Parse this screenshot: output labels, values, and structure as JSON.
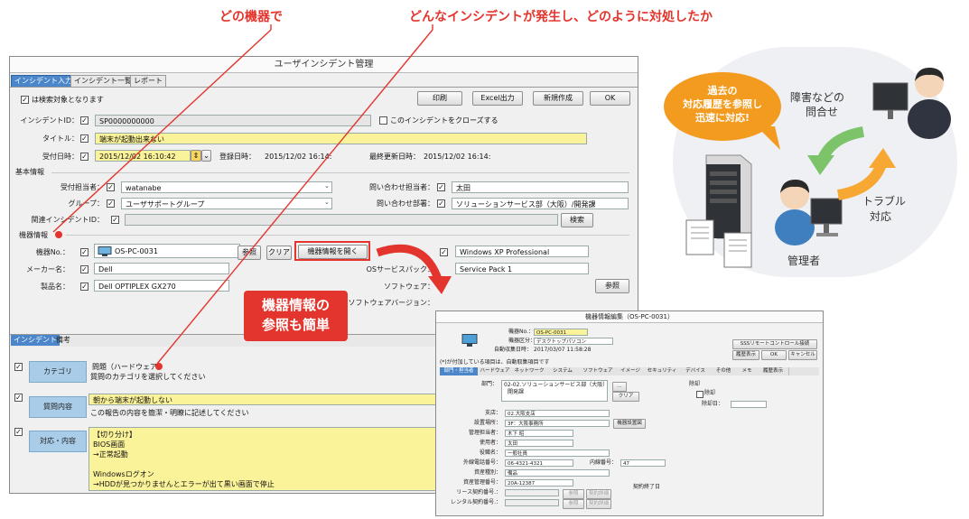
{
  "callouts": {
    "which_device": "どの機器で",
    "what_incident": "どんなインシデントが発生し、どのように対処したか"
  },
  "main_window": {
    "title": "ユーザインシデント管理",
    "tabs": [
      "インシデント入力",
      "インシデント一覧",
      "レポート"
    ],
    "search_target_label": "は検索対象となります",
    "toolbar": {
      "print": "印刷",
      "excel": "Excel出力",
      "new": "新規作成",
      "ok": "OK"
    },
    "incident_id_label": "インシデントID：",
    "incident_id_value": "SP0000000000",
    "close_label": "このインシデントをクローズする",
    "title_label": "タイトル：",
    "title_value": "端末が起動出来ない",
    "received_label": "受付日時：",
    "received_value": "2015/12/02 16:10:42",
    "registered_label": "登録日時：",
    "registered_value": "2015/12/02 16:14:",
    "updated_label": "最終更新日時：",
    "updated_value": "2015/12/02 16:14:",
    "basic_section": "基本情報",
    "receiver_label": "受付担当者：",
    "receiver_value": "watanabe",
    "group_label": "グループ：",
    "group_value": "ユーザサポートグループ",
    "contact_label": "問い合わせ担当者：",
    "contact_value": "太田",
    "dept_label": "問い合わせ部署：",
    "dept_value": "ソリューションサービス部（大阪）/開発課",
    "related_label": "関連インシデントID：",
    "search_button": "検索",
    "device_section": "機器情報",
    "device_no_label": "機器No.：",
    "device_no_value": "OS-PC-0031",
    "ref_button": "参照",
    "clear_button": "クリア",
    "open_device_button": "機器情報を開く",
    "maker_label": "メーカー名：",
    "maker_value": "Dell",
    "product_label": "製品名：",
    "product_value": "Dell OPTIPLEX GX270",
    "os_value": "Windows XP Professional",
    "os_service_label": "OSサービスパック：",
    "os_service_value": "Service Pack 1",
    "software_label": "ソフトウェア：",
    "software_ref_button": "参照",
    "software_version_label": "ソフトウェアバージョン：",
    "bottom_tabs": [
      "インシデント",
      "備考"
    ],
    "category_button": "カテゴリ",
    "category_value": "問題（ハードウェア）",
    "category_hint": "質問のカテゴリを選択してください",
    "question_button": "質問内容",
    "question_value": "朝から端末が起動しない",
    "question_hint": "この報告の内容を簡潔・明瞭に記述してください",
    "response_button": "対応・内容",
    "response_lines": [
      "【切り分け】",
      "BIOS画面",
      "→正常起動",
      "",
      "Windowsログオン",
      "→HDDが見つかりませんとエラーが出て黒い画面で停止"
    ]
  },
  "balloon": {
    "line1": "機器情報の",
    "line2": "参照も簡単"
  },
  "device_window": {
    "title": "機器情報編集（OS-PC-0031）",
    "device_no_label": "機器No.：",
    "device_no_value": "OS-PC-0031",
    "category_label": "機器区分：",
    "category_value": "デスクトップパソコン",
    "created_label": "自動収集日時：",
    "created_value": "2017/03/07 11:58:28",
    "note": "(*)が付加している項目は、自動取集項目です",
    "buttons": {
      "remote": "SSSリモートコントロール接続",
      "history": "履歴表示",
      "ok": "OK",
      "cancel": "キャンセル"
    },
    "tabs": [
      "部門・担当者",
      "ハードウェア",
      "ネットワーク",
      "システム",
      "ソフトウェア",
      "イメージ",
      "セキュリティ",
      "デバイス",
      "その他",
      "メモ",
      "履歴表示"
    ],
    "dept_label": "部門：",
    "dept_value": "02-02.ソリューションサービス部（大阪）",
    "dept_sub": "開発課",
    "clear_button": "クリア",
    "disposal_section": "除却",
    "disposal_check": "除却",
    "disposal_date_label": "除却日：",
    "branch_label": "支店：",
    "branch_value": "02.大阪支店",
    "location_label": "設置場所：",
    "location_value": "3F：大阪事務所",
    "location_image_button": "機器設置図",
    "manager_label": "管理担当者：",
    "manager_value": "木下 昭",
    "user_label": "使用者：",
    "user_value": "太田",
    "user_type_label": "役職名：",
    "user_type_value": "一般社員",
    "ext_phone_label": "外線電話番号：",
    "ext_phone_value": "06-4321-4321",
    "int_phone_label": "内線番号：",
    "int_phone_value": "47",
    "asset_type_label": "資産種別：",
    "asset_type_value": "備品",
    "asset_no_label": "資産管理番号：",
    "asset_no_value": "20A-12387",
    "contract_end_label": "契約終了日",
    "lease_label": "リース契約番号.：",
    "rental_label": "レンタル契約番号.：",
    "ref_small": "参照",
    "contract_small": "契約詳細"
  },
  "illustration": {
    "bubble": [
      "過去の",
      "対応履歴を参照し",
      "迅速に対応!"
    ],
    "inquiry": [
      "障害などの",
      "問合せ"
    ],
    "trouble": [
      "トラブル",
      "対応"
    ],
    "admin": "管理者"
  }
}
